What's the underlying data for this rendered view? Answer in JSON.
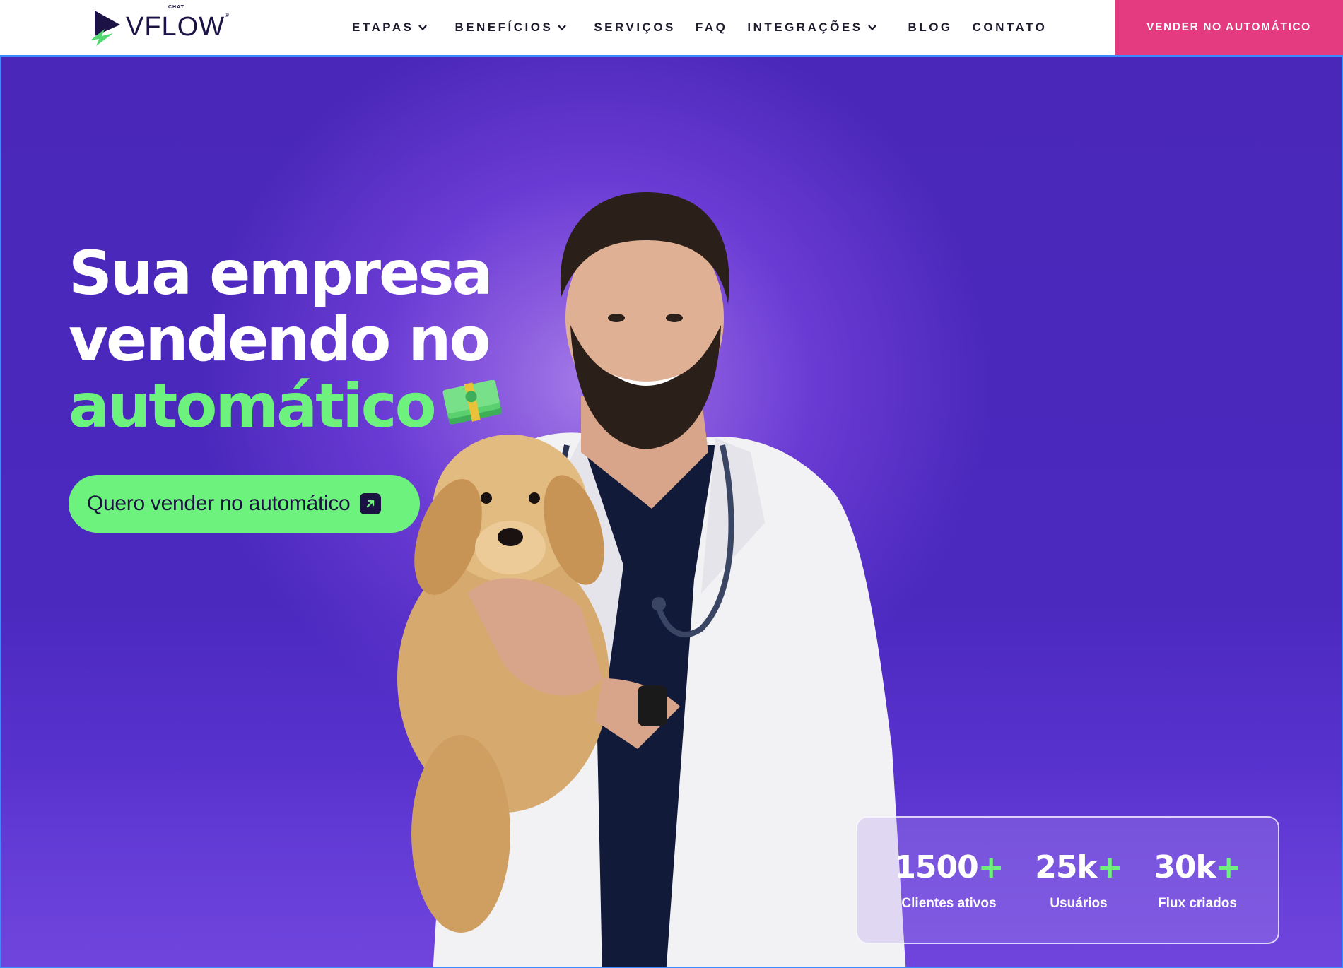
{
  "brand": {
    "small": "CHAT",
    "name": "VFLOW",
    "reg": "®",
    "colors": {
      "navy": "#1d1246",
      "green": "#6ef27e",
      "pink": "#e43a7f",
      "purple": "#4b29bf"
    }
  },
  "nav": {
    "items": [
      {
        "label": "ETAPAS",
        "dropdown": true
      },
      {
        "label": "BENEFÍCIOS",
        "dropdown": true
      },
      {
        "label": "SERVIÇOS",
        "dropdown": false
      },
      {
        "label": "FAQ",
        "dropdown": false
      },
      {
        "label": "INTEGRAÇÕES",
        "dropdown": true
      },
      {
        "label": "BLOG",
        "dropdown": false
      },
      {
        "label": "CONTATO",
        "dropdown": false
      }
    ],
    "cta_label": "VENDER NO AUTOMÁTICO"
  },
  "hero": {
    "line1": "Sua empresa",
    "line2": "vendendo no",
    "line3": "automático",
    "emoji_icon": "money-stack-icon",
    "cta_label": "Quero vender no automático",
    "cta_icon": "arrow-up-right-icon"
  },
  "stats": [
    {
      "value": "1500",
      "plus": "+",
      "label": "Clientes ativos"
    },
    {
      "value": "25k",
      "plus": "+",
      "label": "Usuários"
    },
    {
      "value": "30k",
      "plus": "+",
      "label": "Flux criados"
    }
  ]
}
